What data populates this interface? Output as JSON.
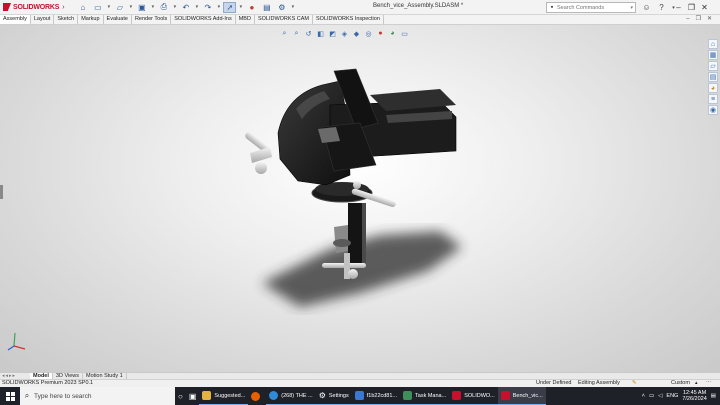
{
  "app": {
    "logo_text": "SOLIDWORKS",
    "document_title": "Bench_vice_Assembly.SLDASM *"
  },
  "search": {
    "placeholder": "Search Commands"
  },
  "command_tabs": [
    {
      "label": "Assembly",
      "active": true
    },
    {
      "label": "Layout"
    },
    {
      "label": "Sketch"
    },
    {
      "label": "Markup"
    },
    {
      "label": "Evaluate"
    },
    {
      "label": "Render Tools"
    },
    {
      "label": "SOLIDWORKS Add-Ins"
    },
    {
      "label": "MBD"
    },
    {
      "label": "SOLIDWORKS CAM"
    },
    {
      "label": "SOLIDWORKS Inspection"
    }
  ],
  "bottom_tabs": [
    {
      "label": "Model",
      "active": true
    },
    {
      "label": "3D Views"
    },
    {
      "label": "Motion Study 1"
    }
  ],
  "status": {
    "version": "SOLIDWORKS Premium 2023 SP0.1",
    "state": "Under Defined",
    "mode": "Editing Assembly",
    "units": "Custom"
  },
  "taskbar": {
    "search_placeholder": "Type here to search",
    "apps": [
      {
        "label": "Suggested...",
        "icon_color": "#e3b341"
      },
      {
        "label": "(268) THE ...",
        "icon_color": "#2f8ad8"
      },
      {
        "label": "Settings",
        "icon_color": "#cfcfcf"
      },
      {
        "label": "f1b22cd81...",
        "icon_color": "#3a78d4"
      },
      {
        "label": "Task Mana...",
        "icon_color": "#3f8f5a"
      },
      {
        "label": "SOLIDWO...",
        "icon_color": "#c8102e"
      },
      {
        "label": "Bench_vic...",
        "icon_color": "#c8102e"
      }
    ],
    "language": "ENG",
    "time": "12:45 AM",
    "date": "7/26/2024"
  },
  "colors": {
    "brand_red": "#c8102e",
    "taskbar_bg": "#1f2129",
    "model_dark": "#1b1b1b",
    "handle_grey": "#d9d9d9"
  }
}
